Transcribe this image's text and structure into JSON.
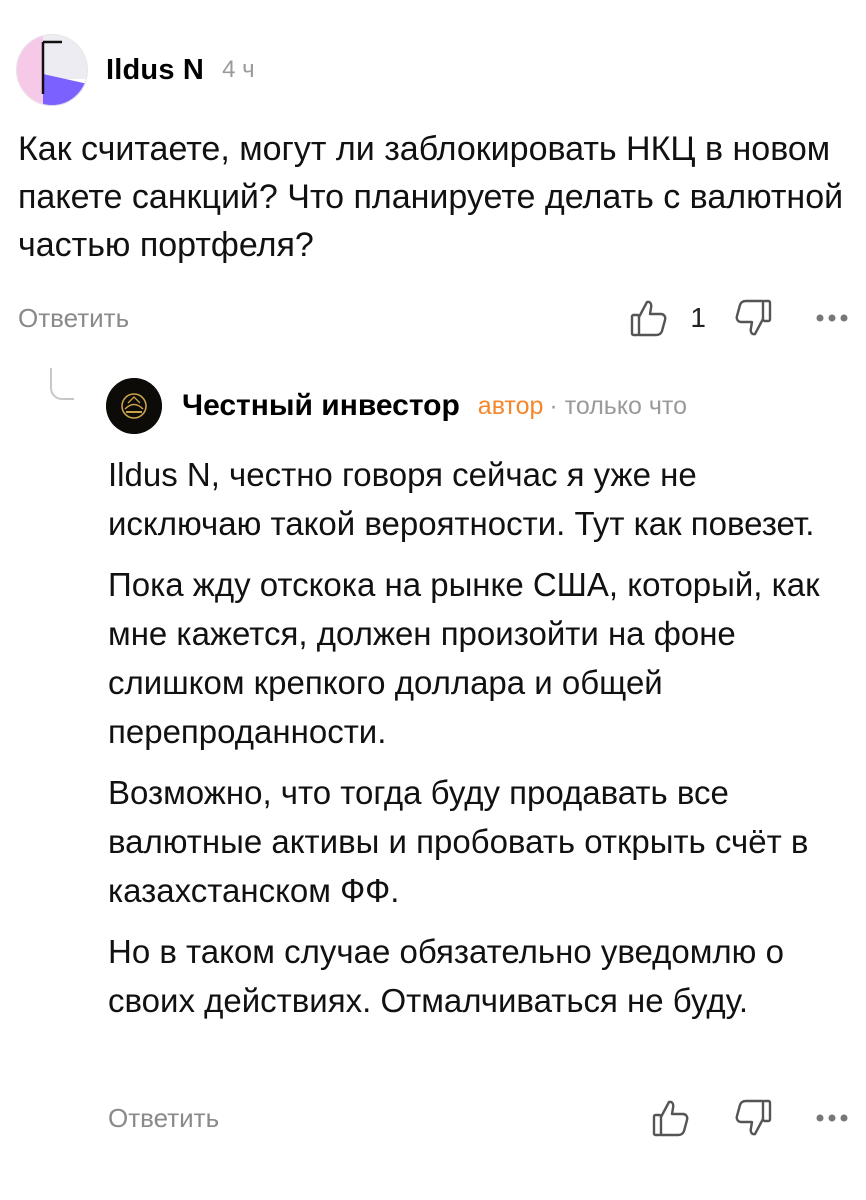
{
  "comment": {
    "author": "Ildus N",
    "time": "4 ч",
    "text": "Как считаете, могут ли заблокировать НКЦ в новом пакете санкций? Что планируете делать с валютной частью портфеля?",
    "reply_label": "Ответить",
    "like_count": "1",
    "icons": [
      "avatar",
      "thumbs-up-icon",
      "thumbs-down-icon",
      "more-icon"
    ]
  },
  "reply": {
    "author": "Честный инвестор",
    "badge": "автор",
    "time": "· только что",
    "paragraphs": [
      "Ildus N, честно говоря сейчас я уже не исключаю такой вероятности. Тут как повезет.",
      "Пока жду отскока на рынке США, который, как мне кажется, должен произойти на фоне слишком крепкого доллара и общей перепроданности.",
      "Возможно, что тогда буду продавать все валютные активы и пробовать открыть счёт в казахстанском ФФ.",
      "Но в таком случае обязательно уведомлю о своих действиях. Отмалчиваться не буду."
    ],
    "reply_label": "Ответить",
    "icons": [
      "thread-line-icon",
      "avatar",
      "thumbs-up-icon",
      "thumbs-down-icon",
      "more-icon"
    ]
  },
  "colors": {
    "accent_badge": "#f5862c",
    "muted_text": "#9a9a9a",
    "avatar_purple": "#7b61ff",
    "avatar_pink": "#f7c9e8"
  }
}
